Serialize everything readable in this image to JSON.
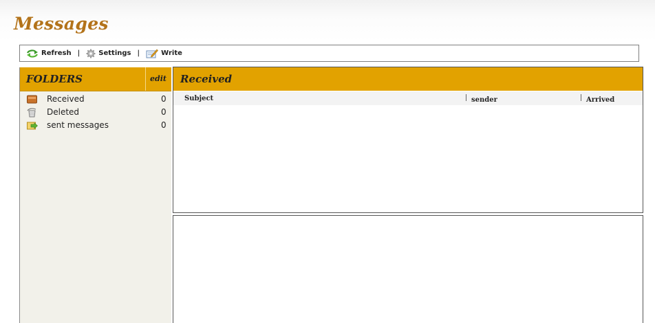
{
  "page": {
    "title": "Messages"
  },
  "toolbar": {
    "refresh_label": "Refresh",
    "refresh_icon": "refresh-icon",
    "settings_label": "Settings",
    "settings_icon": "gear-icon",
    "write_label": "Write",
    "write_icon": "write-icon",
    "separator": "|"
  },
  "folders": {
    "title": "FOLDERS",
    "edit_label": "edit",
    "items": [
      {
        "name": "Received",
        "count": "0",
        "icon": "inbox-icon"
      },
      {
        "name": "Deleted",
        "count": "0",
        "icon": "trash-icon"
      },
      {
        "name": "sent messages",
        "count": "0",
        "icon": "sent-icon"
      }
    ]
  },
  "received": {
    "title": "Received",
    "columns": {
      "subject": "Subject",
      "sender": "sender",
      "arrived": "Arrived"
    }
  },
  "colors": {
    "accent": "#e2a200",
    "title": "#b3731a",
    "sidebar_bg": "#f2f1ea"
  }
}
